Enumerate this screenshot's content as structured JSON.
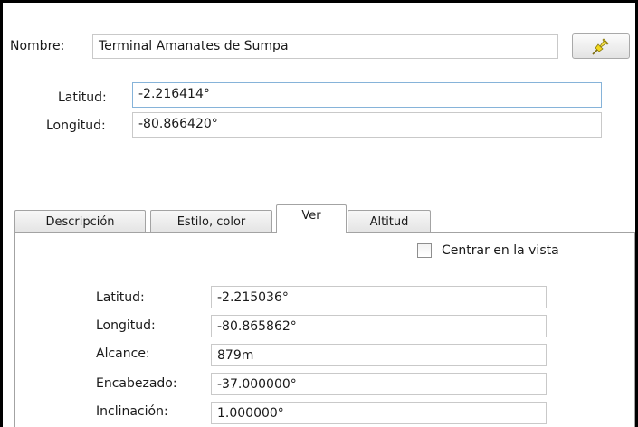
{
  "header": {
    "name_label": "Nombre:",
    "name_value": "Terminal Amanates de Sumpa",
    "latitude_label": "Latitud:",
    "latitude_value": "-2.216414°",
    "longitude_label": "Longitud:",
    "longitude_value": "-80.866420°",
    "pin_icon": "pushpin-icon",
    "pin_color": "#f2d81c"
  },
  "tabs": [
    {
      "label": "Descripción"
    },
    {
      "label": "Estilo, color"
    },
    {
      "label": "Ver"
    },
    {
      "label": "Altitud"
    }
  ],
  "active_tab": "Ver",
  "view": {
    "center_label": "Centrar en la vista",
    "center_checked": false,
    "fields": [
      {
        "label": "Latitud:",
        "value": "-2.215036°"
      },
      {
        "label": "Longitud:",
        "value": "-80.865862°"
      },
      {
        "label": "Alcance:",
        "value": "879m"
      },
      {
        "label": "Encabezado:",
        "value": "-37.000000°"
      },
      {
        "label": "Inclinación:",
        "value": "1.000000°"
      }
    ]
  }
}
